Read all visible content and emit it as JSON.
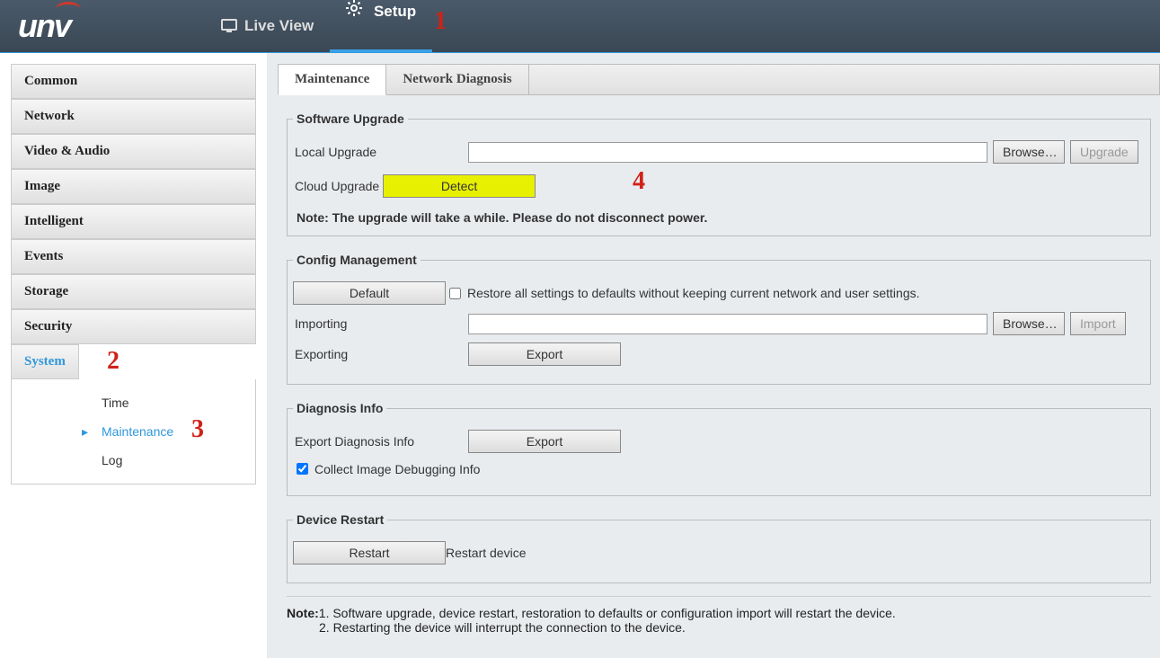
{
  "header": {
    "logo_text": "unv",
    "nav": {
      "live_view": "Live View",
      "setup": "Setup"
    }
  },
  "annotations": {
    "n1": "1",
    "n2": "2",
    "n3": "3",
    "n4": "4"
  },
  "sidebar": {
    "items": [
      {
        "label": "Common"
      },
      {
        "label": "Network"
      },
      {
        "label": "Video & Audio"
      },
      {
        "label": "Image"
      },
      {
        "label": "Intelligent"
      },
      {
        "label": "Events"
      },
      {
        "label": "Storage"
      },
      {
        "label": "Security"
      },
      {
        "label": "System"
      }
    ],
    "sub": {
      "time": "Time",
      "maintenance": "Maintenance",
      "log": "Log"
    }
  },
  "tabs": {
    "maintenance": "Maintenance",
    "network_diagnosis": "Network Diagnosis"
  },
  "upgrade": {
    "legend": "Software Upgrade",
    "local_label": "Local Upgrade",
    "local_value": "",
    "browse": "Browse…",
    "upgrade_btn": "Upgrade",
    "cloud_label": "Cloud Upgrade",
    "detect": "Detect",
    "note": "Note: The upgrade will take a while. Please do not disconnect power."
  },
  "config": {
    "legend": "Config Management",
    "default_btn": "Default",
    "restore_label": "Restore all settings to defaults without keeping current network and user settings.",
    "importing_label": "Importing",
    "importing_value": "",
    "browse": "Browse…",
    "import_btn": "Import",
    "exporting_label": "Exporting",
    "export_btn": "Export"
  },
  "diag": {
    "legend": "Diagnosis Info",
    "export_label": "Export Diagnosis Info",
    "export_btn": "Export",
    "collect_label": "Collect Image Debugging Info"
  },
  "restart": {
    "legend": "Device Restart",
    "btn": "Restart",
    "desc": "Restart device"
  },
  "notes": {
    "label": "Note:",
    "l1": "1. Software upgrade, device restart, restoration to defaults or configuration import will restart the device.",
    "l2": "2. Restarting the device will interrupt the connection to the device."
  }
}
